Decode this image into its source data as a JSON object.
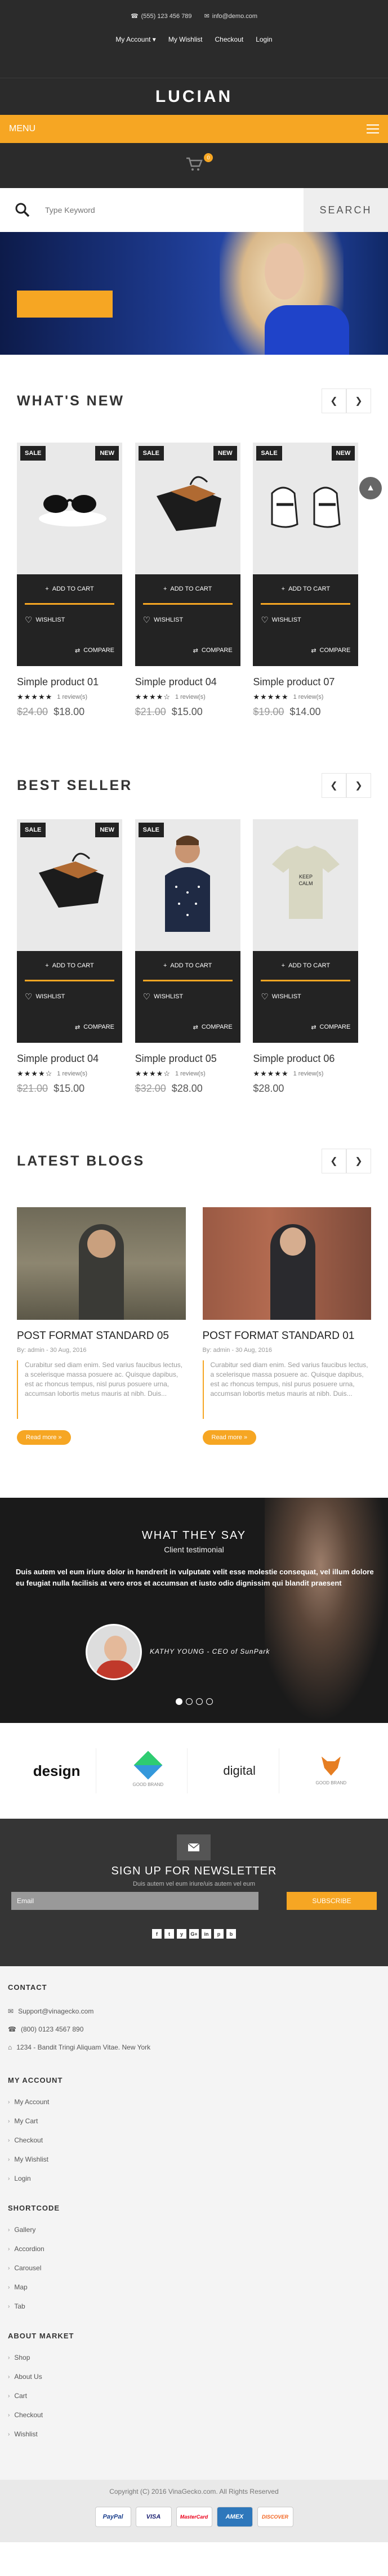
{
  "topbar": {
    "phone": "(555) 123 456 789",
    "email": "info@demo.com",
    "links": [
      "My Account",
      "My Wishlist",
      "Checkout",
      "Login"
    ]
  },
  "header": {
    "logo": "LUCIAN"
  },
  "menu": {
    "label": "MENU"
  },
  "cart": {
    "count": "0"
  },
  "search": {
    "placeholder": "Type Keyword",
    "button": "SEARCH"
  },
  "whats_new": {
    "title": "WHAT'S NEW",
    "products": [
      {
        "sale": "SALE",
        "new": "NEW",
        "name": "Simple product 01",
        "stars": "★★★★★",
        "reviews": "1 review(s)",
        "old_price": "$24.00",
        "price": "$18.00",
        "image": "sunglasses"
      },
      {
        "sale": "SALE",
        "new": "NEW",
        "name": "Simple product 04",
        "stars": "★★★★☆",
        "reviews": "1 review(s)",
        "old_price": "$21.00",
        "price": "$15.00",
        "image": "bag"
      },
      {
        "sale": "SALE",
        "new": "NEW",
        "name": "Simple product 07",
        "stars": "★★★★★",
        "reviews": "1 review(s)",
        "old_price": "$19.00",
        "price": "$14.00",
        "image": "sneakers"
      }
    ]
  },
  "best_seller": {
    "title": "BEST SELLER",
    "products": [
      {
        "sale": "SALE",
        "new": "NEW",
        "name": "Simple product 04",
        "stars": "★★★★☆",
        "reviews": "1 review(s)",
        "old_price": "$21.00",
        "price": "$15.00",
        "image": "bag"
      },
      {
        "sale": "SALE",
        "new": "",
        "name": "Simple product 05",
        "stars": "★★★★☆",
        "reviews": "1 review(s)",
        "old_price": "$32.00",
        "price": "$28.00",
        "image": "man"
      },
      {
        "sale": "",
        "new": "",
        "name": "Simple product 06",
        "stars": "★★★★★",
        "reviews": "1 review(s)",
        "old_price": "",
        "price": "$28.00",
        "image": "tshirt"
      }
    ]
  },
  "product_actions": {
    "add_to_cart": "ADD TO CART",
    "wishlist": "WISHLIST",
    "compare": "COMPARE"
  },
  "blogs": {
    "title": "LATEST BLOGS",
    "posts": [
      {
        "title": "POST FORMAT STANDARD 05",
        "meta": "By: admin - 30 Aug, 2016",
        "text": "Curabitur sed diam enim. Sed varius faucibus lectus, a scelerisque massa posuere ac. Quisque dapibus, est ac rhoncus tempus, nisl purus posuere urna, accumsan lobortis metus mauris at nibh. Duis...",
        "more": "Read more »"
      },
      {
        "title": "POST FORMAT STANDARD 01",
        "meta": "By: admin - 30 Aug, 2016",
        "text": "Curabitur sed diam enim. Sed varius faucibus lectus, a scelerisque massa posuere ac. Quisque dapibus, est ac rhoncus tempus, nisl purus posuere urna, accumsan lobortis metus mauris at nibh. Duis...",
        "more": "Read more »"
      }
    ]
  },
  "testimonial": {
    "title": "WHAT THEY SAY",
    "subtitle": "Client testimonial",
    "text": "Duis autem vel eum iriure dolor in hendrerit in vulputate velit esse molestie consequat, vel illum dolore eu feugiat nulla facilisis at vero eros et accumsan et iusto odio dignissim qui blandit praesent",
    "author": "KATHY YOUNG - CEO of SunPark"
  },
  "brands": [
    "design",
    "GOOD BRAND",
    "digital",
    "GOOD BRAND"
  ],
  "newsletter": {
    "title": "SIGN UP FOR NEWSLETTER",
    "subtitle": "Duis autem vel eum iriure/uis autem vel eum",
    "placeholder": "Email",
    "button": "SUBSCRIBE",
    "social": [
      "f",
      "t",
      "y",
      "G+",
      "in",
      "p",
      "b"
    ]
  },
  "footer": {
    "contact": {
      "title": "CONTACT",
      "email": "Support@vinagecko.com",
      "phone": "(800) 0123 4567 890",
      "address": "1234 - Bandit Tringi Aliquam Vitae. New York"
    },
    "my_account": {
      "title": "MY ACCOUNT",
      "items": [
        "My Account",
        "My Cart",
        "Checkout",
        "My Wishlist",
        "Login"
      ]
    },
    "shortcode": {
      "title": "SHORTCODE",
      "items": [
        "Gallery",
        "Accordion",
        "Carousel",
        "Map",
        "Tab"
      ]
    },
    "about": {
      "title": "ABOUT MARKET",
      "items": [
        "Shop",
        "About Us",
        "Cart",
        "Checkout",
        "Wishlist"
      ]
    }
  },
  "copyright": "Copyright (C) 2016 VinaGecko.com. All Rights Reserved",
  "payments": [
    "PayPal",
    "VISA",
    "MasterCard",
    "AMEX",
    "DISCOVER"
  ],
  "colors": {
    "accent": "#f6a623",
    "dark": "#2b2b2b"
  }
}
